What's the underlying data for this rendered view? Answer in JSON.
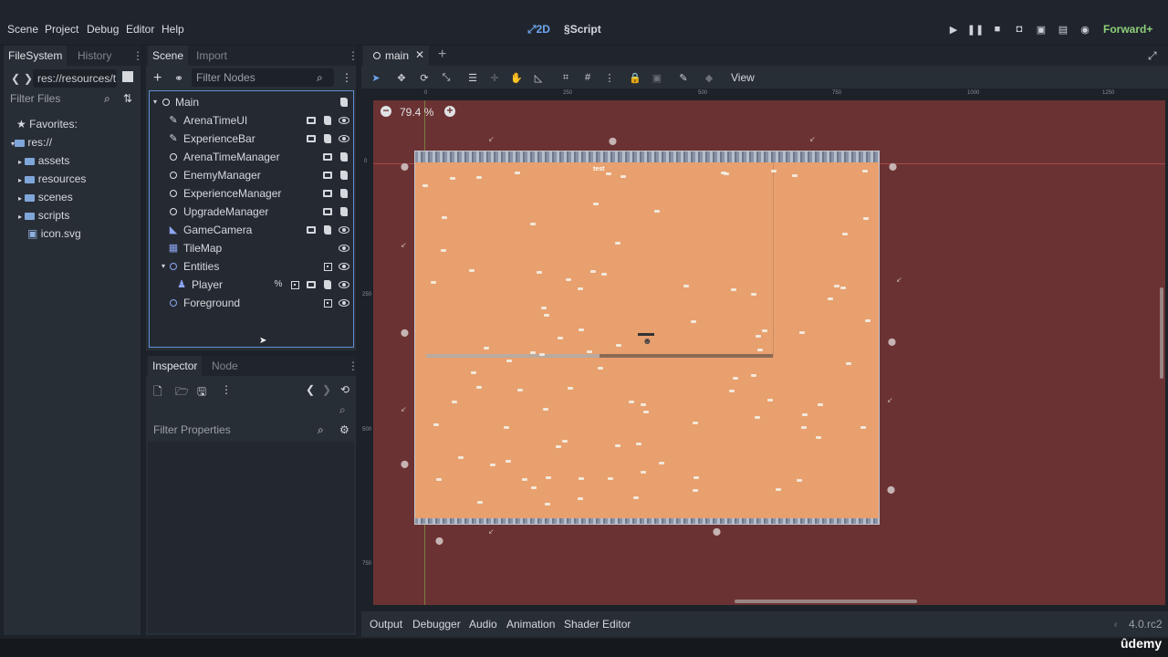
{
  "menubar": {
    "items": [
      "Scene",
      "Project",
      "Debug",
      "Editor",
      "Help"
    ],
    "mode_2d": "2D",
    "mode_script": "Script",
    "renderer": "Forward+"
  },
  "filesystem": {
    "tab_active": "FileSystem",
    "tab_inactive": "History",
    "path": "res://resources/t",
    "filter_placeholder": "Filter Files",
    "favorites": "Favorites:",
    "root": "res://",
    "items": [
      "assets",
      "resources",
      "scenes",
      "scripts",
      "icon.svg"
    ]
  },
  "scene_dock": {
    "tab_active": "Scene",
    "tab_inactive": "Import",
    "filter_placeholder": "Filter Nodes",
    "nodes": [
      "Main",
      "ArenaTimeUI",
      "ExperienceBar",
      "ArenaTimeManager",
      "EnemyManager",
      "ExperienceManager",
      "UpgradeManager",
      "GameCamera",
      "TileMap",
      "Entities",
      "Player",
      "Foreground"
    ]
  },
  "inspector": {
    "tab_active": "Inspector",
    "tab_inactive": "Node",
    "filter_placeholder": "Filter Properties"
  },
  "editor": {
    "tab_label": "main",
    "zoom": "79.4 %",
    "view_menu": "View",
    "ruler_h": [
      "0",
      "250",
      "500",
      "750",
      "1000",
      "1250"
    ],
    "ruler_v": [
      "0",
      "250",
      "500",
      "750"
    ],
    "test_label": "test"
  },
  "bottom_panel": {
    "tabs": [
      "Output",
      "Debugger",
      "Audio",
      "Animation",
      "Shader Editor"
    ],
    "version": "4.0.rc2"
  },
  "watermark": "ûdemy",
  "colors": {
    "accent": "#6ea7f0",
    "viewport_bg": "#6b3233",
    "arena_floor": "#e8a06e",
    "selection": "#5f8fd6"
  }
}
